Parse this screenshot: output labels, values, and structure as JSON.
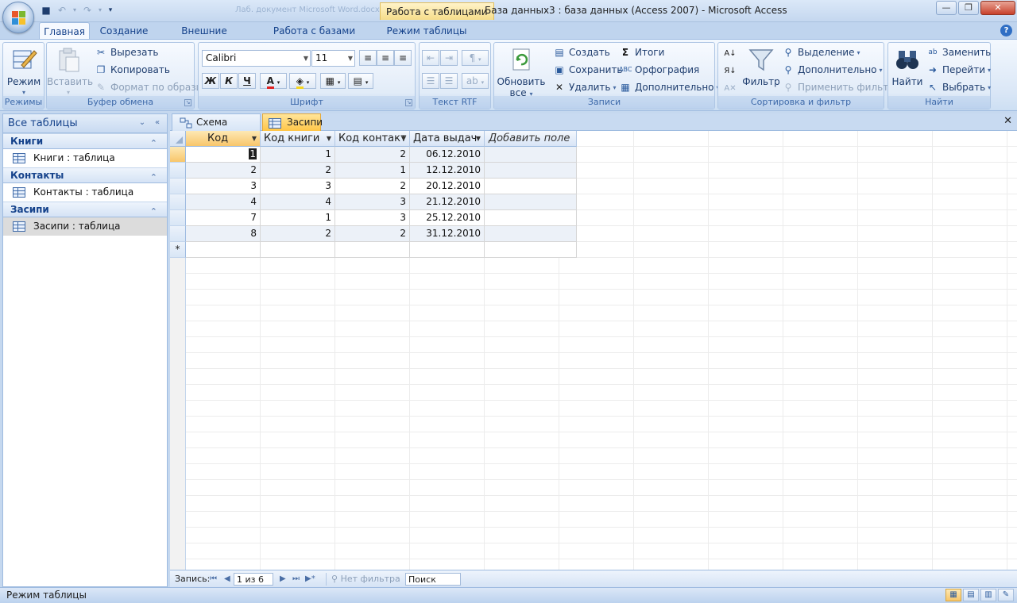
{
  "window": {
    "context_tab": "Работа с таблицами",
    "title": "База данных3 : база данных (Access 2007) - Microsoft Access",
    "ghost_title": "Лаб. документ Microsoft Word.docx"
  },
  "ribbon_tabs": [
    "Главная",
    "Создание",
    "Внешние данные",
    "Работа с базами данных",
    "Режим таблицы"
  ],
  "ribbon": {
    "views": {
      "mode": "Режим",
      "label": "Режимы"
    },
    "clipboard": {
      "paste": "Вставить",
      "cut": "Вырезать",
      "copy": "Копировать",
      "format_painter": "Формат по образцу",
      "label": "Буфер обмена"
    },
    "font": {
      "font_name": "Calibri",
      "font_size": "11",
      "bold": "Ж",
      "italic": "К",
      "underline": "Ч",
      "label": "Шрифт"
    },
    "rtf": {
      "label": "Текст RTF"
    },
    "records": {
      "refresh": "Обновить",
      "refresh2": "все",
      "new": "Создать",
      "save": "Сохранить",
      "delete": "Удалить",
      "totals": "Итоги",
      "spelling": "Орфография",
      "more": "Дополнительно",
      "label": "Записи"
    },
    "sort_filter": {
      "filter": "Фильтр",
      "selection": "Выделение",
      "advanced": "Дополнительно",
      "toggle_filter": "Применить фильтр",
      "label": "Сортировка и фильтр"
    },
    "find": {
      "find": "Найти",
      "replace": "Заменить",
      "goto": "Перейти",
      "select": "Выбрать",
      "label": "Найти"
    }
  },
  "nav_pane": {
    "title": "Все таблицы",
    "groups": [
      {
        "name": "Книги",
        "item": "Книги : таблица"
      },
      {
        "name": "Контакты",
        "item": "Контакты : таблица"
      },
      {
        "name": "Засипи",
        "item": "Засипи : таблица"
      }
    ]
  },
  "doc_tabs": [
    "Схема данных",
    "Засипи"
  ],
  "table": {
    "columns": [
      "Код",
      "Код книги",
      "Код контакт",
      "Дата выдач",
      "Добавить поле"
    ],
    "rows": [
      [
        "1",
        "1",
        "2",
        "06.12.2010"
      ],
      [
        "2",
        "2",
        "1",
        "12.12.2010"
      ],
      [
        "3",
        "3",
        "2",
        "20.12.2010"
      ],
      [
        "4",
        "4",
        "3",
        "21.12.2010"
      ],
      [
        "7",
        "1",
        "3",
        "25.12.2010"
      ],
      [
        "8",
        "2",
        "2",
        "31.12.2010"
      ]
    ],
    "new_row_marker": "*"
  },
  "record_nav": {
    "label": "Запись:",
    "position": "1 из 6",
    "filter": "Нет фильтра",
    "search": "Поиск"
  },
  "status": {
    "mode": "Режим таблицы"
  },
  "colors": {
    "accent": "#15428b",
    "ribbon_bg": "#dce8f7",
    "active_tab": "#ffc547",
    "alt_row": "#ecf1f8"
  }
}
